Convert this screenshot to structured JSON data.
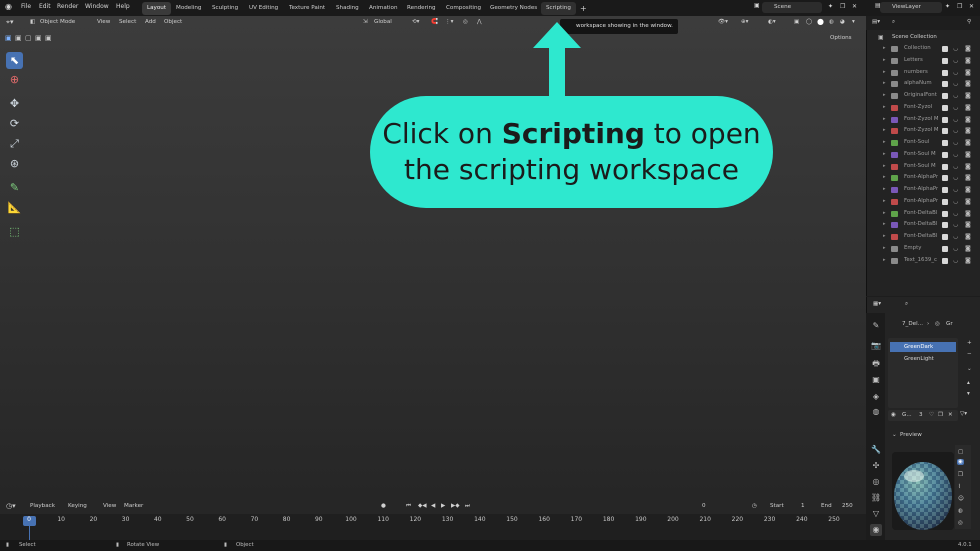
{
  "top_menu": [
    "File",
    "Edit",
    "Render",
    "Window",
    "Help"
  ],
  "workspace_tabs": [
    "Layout",
    "Modeling",
    "Sculpting",
    "UV Editing",
    "Texture Paint",
    "Shading",
    "Animation",
    "Rendering",
    "Compositing",
    "Geometry Nodes",
    "Scripting"
  ],
  "active_tab": "Layout",
  "scene_name": "Scene",
  "view_layer": "ViewLayer",
  "viewport_header": {
    "mode": "Object Mode",
    "menus": [
      "View",
      "Select",
      "Add",
      "Object"
    ],
    "orientation": "Global",
    "options": "Options"
  },
  "tooltip": "workspace showing in the window.",
  "callout": {
    "line1_pre": "Click on ",
    "line1_bold": "Scripting",
    "line1_post": " to open",
    "line2": "the scripting workspace",
    "color": "#2ee8cf"
  },
  "outliner": {
    "title": "Scene Collection",
    "rows": [
      {
        "name": "Collection",
        "color": "#8a8a8a"
      },
      {
        "name": "Letters",
        "color": "#8a8a8a"
      },
      {
        "name": "numbers",
        "color": "#8a8a8a"
      },
      {
        "name": "alphaNum",
        "color": "#8a8a8a"
      },
      {
        "name": "OriginalFont",
        "color": "#8a8a8a"
      },
      {
        "name": "Font-Zyzol",
        "color": "#c04a4a"
      },
      {
        "name": "Font-Zyzol M",
        "color": "#7a58b8"
      },
      {
        "name": "Font-Zyzol M",
        "color": "#c04a4a"
      },
      {
        "name": "Font-Soul",
        "color": "#5fa34a"
      },
      {
        "name": "Font-Soul M",
        "color": "#7a58b8"
      },
      {
        "name": "Font-Soul M",
        "color": "#c04a4a"
      },
      {
        "name": "Font-AlphaPr",
        "color": "#5fa34a"
      },
      {
        "name": "Font-AlphaPr",
        "color": "#7a58b8"
      },
      {
        "name": "Font-AlphaPr",
        "color": "#c04a4a"
      },
      {
        "name": "Font-DeltaBl",
        "color": "#5fa34a"
      },
      {
        "name": "Font-DeltaBl",
        "color": "#7a58b8"
      },
      {
        "name": "Font-DeltaBl",
        "color": "#c04a4a"
      },
      {
        "name": "Empty",
        "color": "#8a8a8a"
      },
      {
        "name": "Text_1639_c",
        "color": "#8a8a8a"
      }
    ]
  },
  "properties": {
    "object_name": "7_Del...",
    "materials": [
      "GreenDark",
      "GreenLight"
    ],
    "slot_label": "G...",
    "slot_count": "3",
    "preview_label": "Preview"
  },
  "timeline": {
    "menus": [
      "Playback",
      "Keying",
      "View",
      "Marker"
    ],
    "current_frame": "0",
    "start_label": "Start",
    "start": "1",
    "end_label": "End",
    "end": "250",
    "ticks": [
      "0",
      "10",
      "20",
      "30",
      "40",
      "50",
      "60",
      "70",
      "80",
      "90",
      "100",
      "110",
      "120",
      "130",
      "140",
      "150",
      "160",
      "170",
      "180",
      "190",
      "200",
      "210",
      "220",
      "230",
      "240",
      "250"
    ]
  },
  "statusbar": {
    "select": "Select",
    "rotate": "Rotate View",
    "object": "Object",
    "version": "4.0.1"
  }
}
